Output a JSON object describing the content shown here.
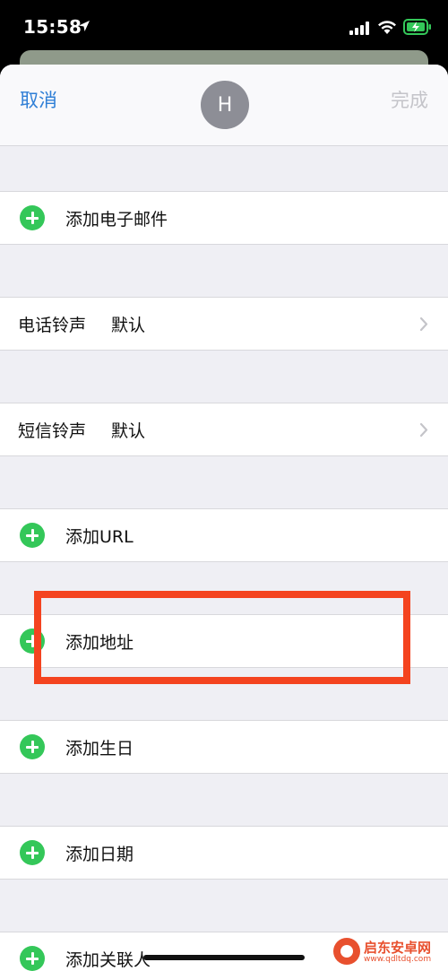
{
  "status_bar": {
    "time": "15:58",
    "icons": [
      "location-arrow-icon",
      "cellular-signal-icon",
      "wifi-icon",
      "battery-charging-icon"
    ]
  },
  "nav": {
    "cancel_label": "取消",
    "avatar_initial": "H",
    "done_label": "完成"
  },
  "rows": {
    "add_email": "添加电子邮件",
    "ringtone_title": "电话铃声",
    "ringtone_value": "默认",
    "text_tone_title": "短信铃声",
    "text_tone_value": "默认",
    "add_url": "添加URL",
    "add_address": "添加地址",
    "add_birthday": "添加生日",
    "add_date": "添加日期",
    "add_related": "添加关联人"
  },
  "colors": {
    "accent": "#2f7fd6",
    "add_green": "#34c759",
    "highlight_red": "#f4431f"
  },
  "watermark": {
    "title": "启东安卓网",
    "url": "www.qdltdq.com"
  }
}
